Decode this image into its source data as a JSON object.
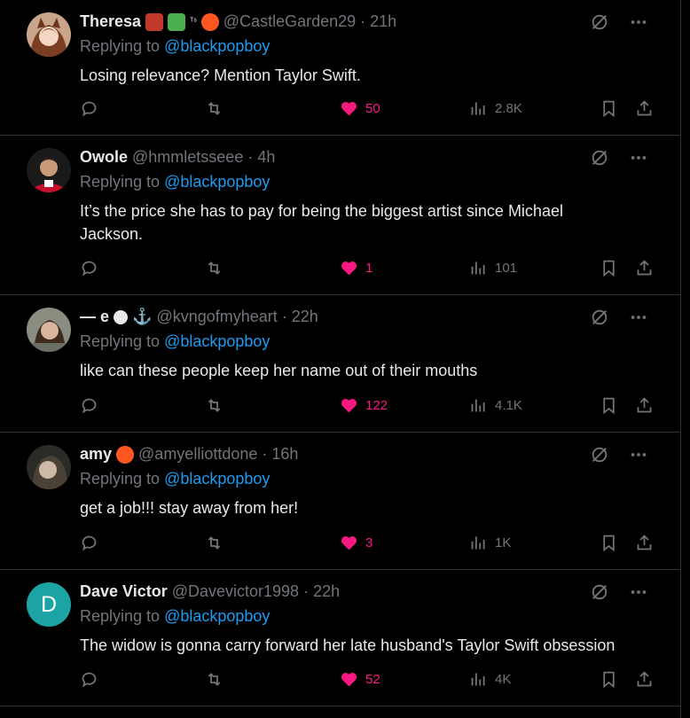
{
  "replies": [
    {
      "name": "Theresa",
      "handle": "@CastleGarden29",
      "time": "21h",
      "replying_prefix": "Replying to",
      "replying_to": "@blackpopboy",
      "text": "Losing relevance? Mention Taylor Swift.",
      "likes": "50",
      "views": "2.8K",
      "badges": [
        "red-devil-emoji",
        "green-book-emoji",
        "ts-emoji",
        "fire-heart-emoji"
      ]
    },
    {
      "name": "Owole",
      "handle": "@hmmletsseee",
      "time": "4h",
      "replying_prefix": "Replying to",
      "replying_to": "@blackpopboy",
      "text": "It’s the price she has to pay for being the biggest artist since Michael Jackson.",
      "likes": "1",
      "views": "101"
    },
    {
      "name": "— e",
      "handle": "@kvngofmyheart",
      "time": "22h",
      "replying_prefix": "Replying to",
      "replying_to": "@blackpopboy",
      "text": "like can these people keep her name out of their mouths",
      "likes": "122",
      "views": "4.1K"
    },
    {
      "name": "amy",
      "handle": "@amyelliottdone",
      "time": "16h",
      "replying_prefix": "Replying to",
      "replying_to": "@blackpopboy",
      "text": "get a job!!! stay away from her!",
      "likes": "3",
      "views": "1K"
    },
    {
      "name": "Dave Victor",
      "handle": "@Davevictor1998",
      "time": "22h",
      "avatar_letter": "D",
      "replying_prefix": "Replying to",
      "replying_to": "@blackpopboy",
      "text": "The widow is gonna carry forward her late husband's Taylor Swift obsession",
      "likes": "52",
      "views": "4K"
    }
  ],
  "colors": {
    "background": "#000000",
    "text": "#e7e9ea",
    "muted": "#71767b",
    "link": "#1d9bf0",
    "like": "#f91880",
    "divider": "#2f3336"
  },
  "dot": "·"
}
